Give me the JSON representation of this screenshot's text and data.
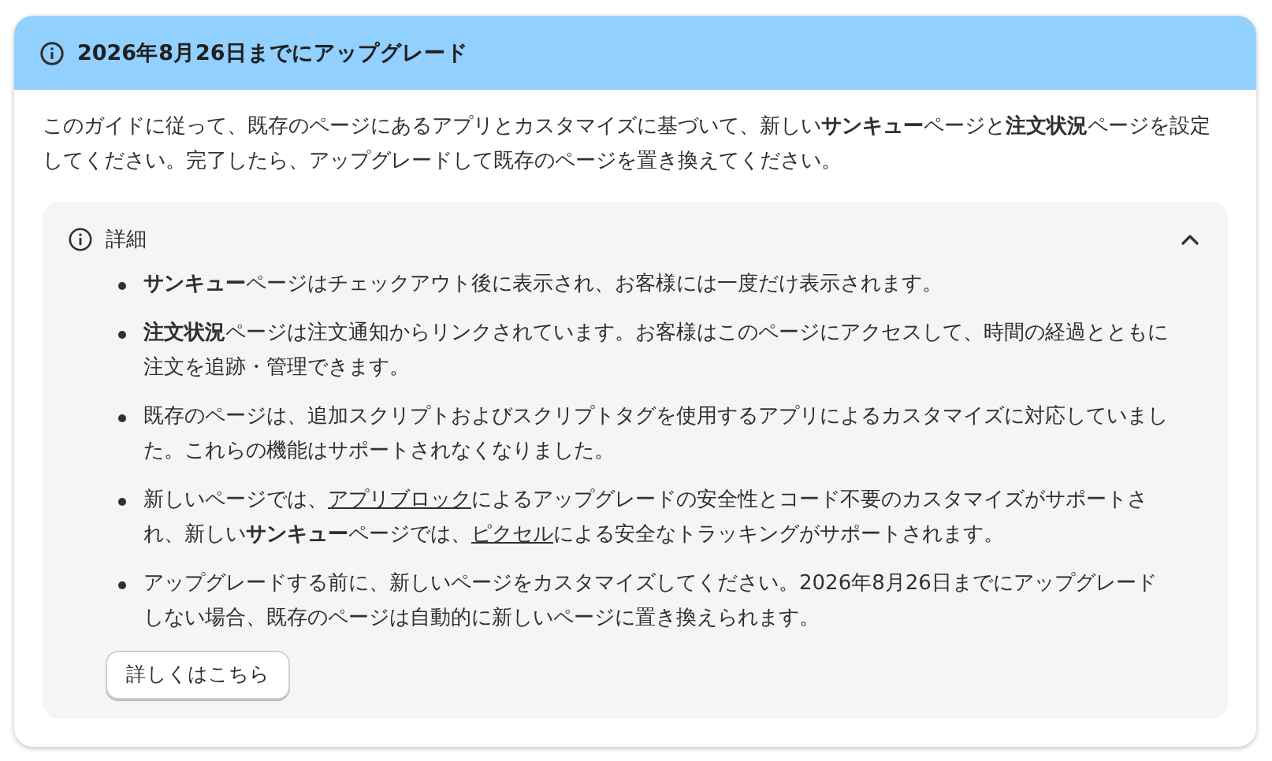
{
  "banner": {
    "title": "2026年8月26日までにアップグレード"
  },
  "intro": "このガイドに従って、既存のページにあるアプリとカスタマイズに基づいて、新しい**サンキュー**ページと**注文状況**ページを設定してください。完了したら、アップグレードして既存のページを置き換えてください。",
  "details": {
    "title": "詳細",
    "expanded": true,
    "items": [
      {
        "segments": [
          {
            "kind": "text",
            "text": "**サンキュー**ページはチェックアウト後に表示され、お客様には一度だけ表示されます。"
          }
        ]
      },
      {
        "segments": [
          {
            "kind": "text",
            "text": "**注文状況**ページは注文通知からリンクされています。お客様はこのページにアクセスして、時間の経過とともに注文を追跡・管理できます。"
          }
        ]
      },
      {
        "segments": [
          {
            "kind": "text",
            "text": "既存のページは、追加スクリプトおよびスクリプトタグを使用するアプリによるカスタマイズに対応していました。これらの機能はサポートされなくなりました。"
          }
        ]
      },
      {
        "segments": [
          {
            "kind": "text",
            "text": "新しいページでは、"
          },
          {
            "kind": "link",
            "text": "アプリブロック"
          },
          {
            "kind": "text",
            "text": "によるアップグレードの安全性とコード不要のカスタマイズがサポートされ、新しい**サンキュー**ページでは、"
          },
          {
            "kind": "link",
            "text": "ピクセル"
          },
          {
            "kind": "text",
            "text": "による安全なトラッキングがサポートされます。"
          }
        ]
      },
      {
        "segments": [
          {
            "kind": "text",
            "text": "アップグレードする前に、新しいページをカスタマイズしてください。2026年8月26日までにアップグレードしない場合、既存のページは自動的に新しいページに置き換えられます。"
          }
        ]
      }
    ],
    "button": "詳しくはこちら"
  }
}
